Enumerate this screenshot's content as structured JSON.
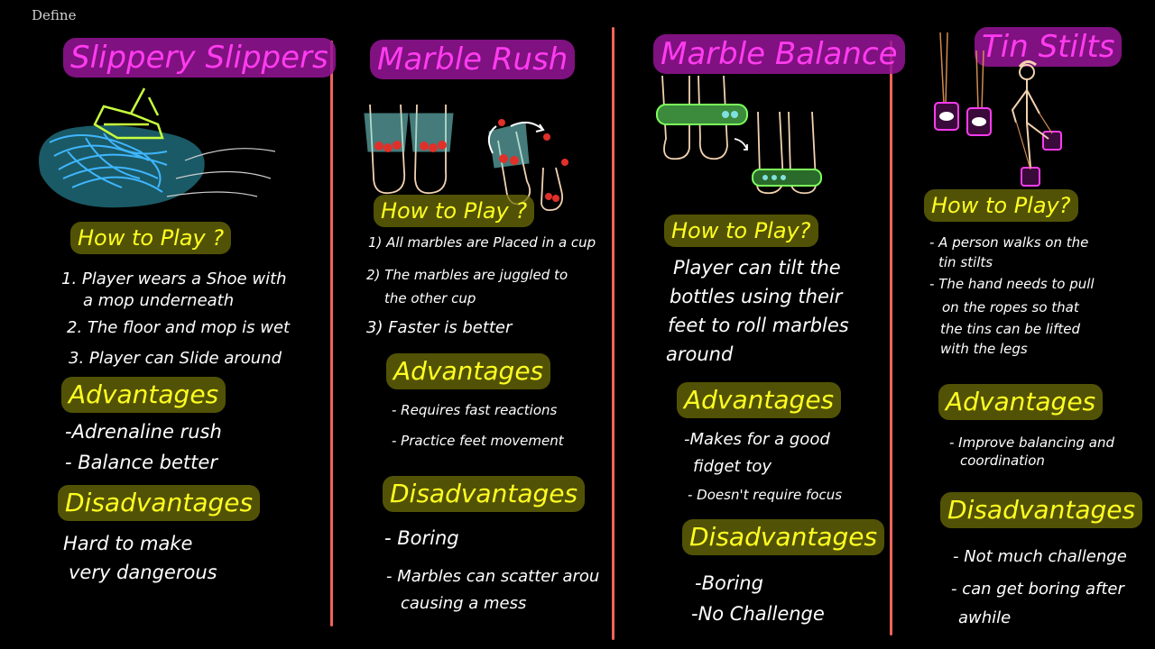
{
  "page": {
    "label": "Define"
  },
  "columns": [
    {
      "title": "Slippery Slippers",
      "how_heading": "How to Play ?",
      "how_steps": [
        "1. Player wears a Shoe with",
        "a mop underneath",
        "2. The floor and mop is wet",
        "3. Player can Slide around"
      ],
      "adv_heading": "Advantages",
      "advantages": [
        "-Adrenaline rush",
        "- Balance better"
      ],
      "dis_heading": "Disadvantages",
      "disadvantages": [
        "Hard to make",
        "very dangerous"
      ]
    },
    {
      "title": "Marble Rush",
      "how_heading": "How to Play ?",
      "how_steps": [
        "1) All marbles are Placed in a cup",
        "2) The marbles are juggled to",
        "the other cup",
        "3) Faster is better"
      ],
      "adv_heading": "Advantages",
      "advantages": [
        "- Requires fast reactions",
        "- Practice feet movement"
      ],
      "dis_heading": "Disadvantages",
      "disadvantages": [
        "- Boring",
        "- Marbles can scatter arou",
        "causing a mess"
      ]
    },
    {
      "title": "Marble Balance",
      "how_heading": "How to Play?",
      "how_steps": [
        "Player can tilt the",
        "bottles using their",
        "feet to roll marbles",
        "around"
      ],
      "adv_heading": "Advantages",
      "advantages": [
        "-Makes for a good",
        "fidget toy",
        "- Doesn't require focus"
      ],
      "dis_heading": "Disadvantages",
      "disadvantages": [
        "-Boring",
        "-No Challenge"
      ]
    },
    {
      "title": "Tin Stilts",
      "how_heading": "How to Play?",
      "how_steps": [
        "- A person walks on the",
        "tin stilts",
        "- The hand needs to pull",
        "on the ropes so that",
        "the tins can be lifted",
        "with the legs"
      ],
      "adv_heading": "Advantages",
      "advantages": [
        "- Improve balancing and",
        "coordination"
      ],
      "dis_heading": "Disadvantages",
      "disadvantages": [
        "- Not much challenge",
        "- can get boring after",
        "awhile"
      ]
    }
  ],
  "colors": {
    "background": "#000000",
    "title": "#ff3cf0",
    "heading": "#ffff22",
    "divider": "#f0645a",
    "mop": "#3fb6ff",
    "shoe": "#c8ff3c",
    "marble": "#e0302a",
    "cup": "#7fe0e0"
  },
  "icons": [
    "mop-slipper-drawing",
    "feet-cups-drawing",
    "juggle-arrows-drawing",
    "feet-bottles-drawing",
    "tin-stilts-drawing"
  ]
}
